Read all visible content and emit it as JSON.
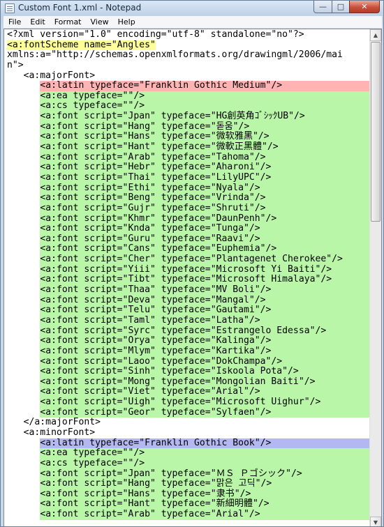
{
  "window": {
    "title": "Custom Font 1.xml - Notepad",
    "minimize_glyph": "—",
    "maximize_glyph": "□",
    "close_glyph": "✕"
  },
  "menu": [
    "File",
    "Edit",
    "Format",
    "View",
    "Help"
  ],
  "scrollbar": {
    "up_glyph": "▲",
    "down_glyph": "▼",
    "thumb_position": 0.0,
    "thumb_fraction": 0.38
  },
  "highlight_colors": {
    "yellow": "#ffff99",
    "red": "#ffb3b3",
    "green": "#b9f6a8",
    "blue": "#b3b8f2"
  },
  "document": {
    "lines": [
      {
        "text": "<?xml version=\"1.0\" encoding=\"utf-8\" standalone=\"no\"?>"
      },
      {
        "text": "<a:fontScheme name=\"Angles\"",
        "hl": "yellow"
      },
      {
        "text": "xmlns:a=\"http://schemas.openxmlformats.org/drawingml/2006/mai"
      },
      {
        "text": "n\">"
      },
      {
        "text": "   <a:majorFont>"
      },
      {
        "text": "      <a:latin typeface=\"Franklin Gothic Medium\"/>",
        "hl": "red",
        "hl_start": 6,
        "hl_width": "ext"
      },
      {
        "text": "      <a:ea typeface=\"\"/>",
        "hl": "green",
        "hl_start": 6,
        "hl_width": "ext"
      },
      {
        "text": "      <a:cs typeface=\"\"/>",
        "hl": "green",
        "hl_start": 6,
        "hl_width": "ext"
      },
      {
        "text": "      <a:font script=\"Jpan\" typeface=\"HG創英角ｺﾞｼｯｸUB\"/>",
        "hl": "green",
        "hl_start": 6,
        "hl_width": "ext"
      },
      {
        "text": "      <a:font script=\"Hang\" typeface=\"돋움\"/>",
        "hl": "green",
        "hl_start": 6,
        "hl_width": "ext"
      },
      {
        "text": "      <a:font script=\"Hans\" typeface=\"微软雅黑\"/>",
        "hl": "green",
        "hl_start": 6,
        "hl_width": "ext"
      },
      {
        "text": "      <a:font script=\"Hant\" typeface=\"微軟正黑體\"/>",
        "hl": "green",
        "hl_start": 6,
        "hl_width": "ext"
      },
      {
        "text": "      <a:font script=\"Arab\" typeface=\"Tahoma\"/>",
        "hl": "green",
        "hl_start": 6,
        "hl_width": "ext"
      },
      {
        "text": "      <a:font script=\"Hebr\" typeface=\"Aharoni\"/>",
        "hl": "green",
        "hl_start": 6,
        "hl_width": "ext"
      },
      {
        "text": "      <a:font script=\"Thai\" typeface=\"LilyUPC\"/>",
        "hl": "green",
        "hl_start": 6,
        "hl_width": "ext"
      },
      {
        "text": "      <a:font script=\"Ethi\" typeface=\"Nyala\"/>",
        "hl": "green",
        "hl_start": 6,
        "hl_width": "ext"
      },
      {
        "text": "      <a:font script=\"Beng\" typeface=\"Vrinda\"/>",
        "hl": "green",
        "hl_start": 6,
        "hl_width": "ext"
      },
      {
        "text": "      <a:font script=\"Gujr\" typeface=\"Shruti\"/>",
        "hl": "green",
        "hl_start": 6,
        "hl_width": "ext"
      },
      {
        "text": "      <a:font script=\"Khmr\" typeface=\"DaunPenh\"/>",
        "hl": "green",
        "hl_start": 6,
        "hl_width": "ext"
      },
      {
        "text": "      <a:font script=\"Knda\" typeface=\"Tunga\"/>",
        "hl": "green",
        "hl_start": 6,
        "hl_width": "ext"
      },
      {
        "text": "      <a:font script=\"Guru\" typeface=\"Raavi\"/>",
        "hl": "green",
        "hl_start": 6,
        "hl_width": "ext"
      },
      {
        "text": "      <a:font script=\"Cans\" typeface=\"Euphemia\"/>",
        "hl": "green",
        "hl_start": 6,
        "hl_width": "ext"
      },
      {
        "text": "      <a:font script=\"Cher\" typeface=\"Plantagenet Cherokee\"/>",
        "hl": "green",
        "hl_start": 6,
        "hl_width": "ext"
      },
      {
        "text": "      <a:font script=\"Yiii\" typeface=\"Microsoft Yi Baiti\"/>",
        "hl": "green",
        "hl_start": 6,
        "hl_width": "ext"
      },
      {
        "text": "      <a:font script=\"Tibt\" typeface=\"Microsoft Himalaya\"/>",
        "hl": "green",
        "hl_start": 6,
        "hl_width": "ext"
      },
      {
        "text": "      <a:font script=\"Thaa\" typeface=\"MV Boli\"/>",
        "hl": "green",
        "hl_start": 6,
        "hl_width": "ext"
      },
      {
        "text": "      <a:font script=\"Deva\" typeface=\"Mangal\"/>",
        "hl": "green",
        "hl_start": 6,
        "hl_width": "ext"
      },
      {
        "text": "      <a:font script=\"Telu\" typeface=\"Gautami\"/>",
        "hl": "green",
        "hl_start": 6,
        "hl_width": "ext"
      },
      {
        "text": "      <a:font script=\"Taml\" typeface=\"Latha\"/>",
        "hl": "green",
        "hl_start": 6,
        "hl_width": "ext"
      },
      {
        "text": "      <a:font script=\"Syrc\" typeface=\"Estrangelo Edessa\"/>",
        "hl": "green",
        "hl_start": 6,
        "hl_width": "ext"
      },
      {
        "text": "      <a:font script=\"Orya\" typeface=\"Kalinga\"/>",
        "hl": "green",
        "hl_start": 6,
        "hl_width": "ext"
      },
      {
        "text": "      <a:font script=\"Mlym\" typeface=\"Kartika\"/>",
        "hl": "green",
        "hl_start": 6,
        "hl_width": "ext"
      },
      {
        "text": "      <a:font script=\"Laoo\" typeface=\"DokChampa\"/>",
        "hl": "green",
        "hl_start": 6,
        "hl_width": "ext"
      },
      {
        "text": "      <a:font script=\"Sinh\" typeface=\"Iskoola Pota\"/>",
        "hl": "green",
        "hl_start": 6,
        "hl_width": "ext"
      },
      {
        "text": "      <a:font script=\"Mong\" typeface=\"Mongolian Baiti\"/>",
        "hl": "green",
        "hl_start": 6,
        "hl_width": "ext"
      },
      {
        "text": "      <a:font script=\"Viet\" typeface=\"Arial\"/>",
        "hl": "green",
        "hl_start": 6,
        "hl_width": "ext"
      },
      {
        "text": "      <a:font script=\"Uigh\" typeface=\"Microsoft Uighur\"/>",
        "hl": "green",
        "hl_start": 6,
        "hl_width": "ext"
      },
      {
        "text": "      <a:font script=\"Geor\" typeface=\"Sylfaen\"/>",
        "hl": "green",
        "hl_start": 6,
        "hl_width": "ext"
      },
      {
        "text": "   </a:majorFont>"
      },
      {
        "text": "   <a:minorFont>"
      },
      {
        "text": "      <a:latin typeface=\"Franklin Gothic Book\"/>",
        "hl": "blue",
        "hl_start": 6,
        "hl_width": "ext"
      },
      {
        "text": "      <a:ea typeface=\"\"/>",
        "hl": "green",
        "hl_start": 6,
        "hl_width": "ext"
      },
      {
        "text": "      <a:cs typeface=\"\"/>",
        "hl": "green",
        "hl_start": 6,
        "hl_width": "ext"
      },
      {
        "text": "      <a:font script=\"Jpan\" typeface=\"ＭＳ Ｐゴシック\"/>",
        "hl": "green",
        "hl_start": 6,
        "hl_width": "ext"
      },
      {
        "text": "      <a:font script=\"Hang\" typeface=\"맑은 고딕\"/>",
        "hl": "green",
        "hl_start": 6,
        "hl_width": "ext"
      },
      {
        "text": "      <a:font script=\"Hans\" typeface=\"隶书\"/>",
        "hl": "green",
        "hl_start": 6,
        "hl_width": "ext"
      },
      {
        "text": "      <a:font script=\"Hant\" typeface=\"新細明體\"/>",
        "hl": "green",
        "hl_start": 6,
        "hl_width": "ext"
      },
      {
        "text": "      <a:font script=\"Arab\" typeface=\"Arial\"/>",
        "hl": "green",
        "hl_start": 6,
        "hl_width": "ext"
      }
    ]
  }
}
